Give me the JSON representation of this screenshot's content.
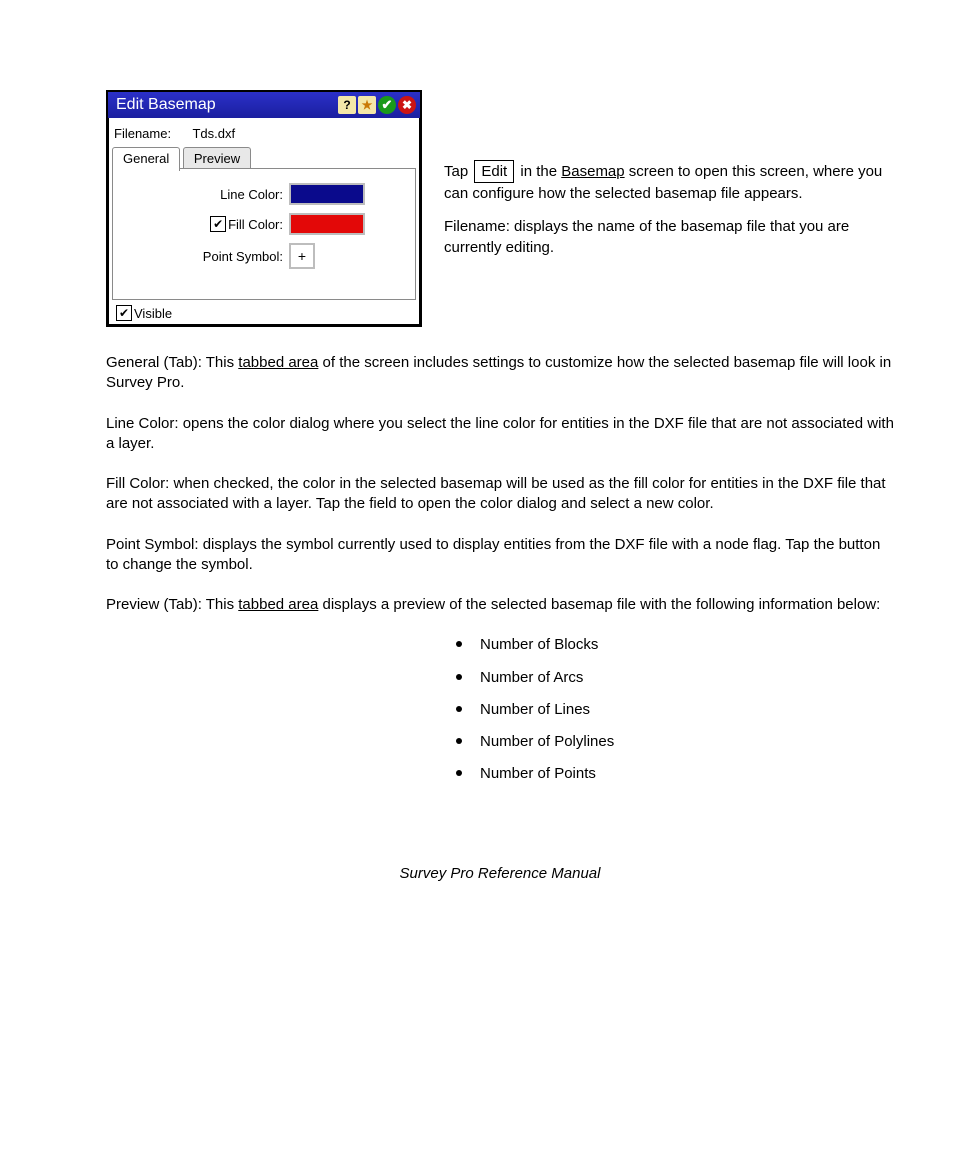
{
  "dialog": {
    "title": "Edit Basemap",
    "filename_label": "Filename:",
    "filename_value": "Tds.dxf",
    "tab_general": "General",
    "tab_preview": "Preview",
    "row_line": "Line Color:",
    "row_fill": "Fill Color:",
    "row_point": "Point Symbol:",
    "point_symbol": "+",
    "visible_label": "Visible",
    "line_color": "#0a0a8c",
    "fill_color": "#e30808",
    "icon_help": "?",
    "icon_star": "★",
    "icon_ok": "✔",
    "icon_cancel": "✖",
    "checkbox_mark": "✔"
  },
  "right": {
    "p1a": "Tap ",
    "p1_btn": "Edit",
    "p1b": " in the ",
    "p1_link": "Basemap",
    "p1c": " screen to open this screen, where you can configure how the selected basemap file appears.",
    "p2": "Filename: displays the name of the basemap file that you are currently editing."
  },
  "body": {
    "p3a": "General (Tab): This ",
    "p3_link": "tabbed area",
    "p3b": " of the screen includes settings to customize how the selected basemap file will look in Survey Pro.",
    "p4": "Line Color: opens the color dialog where you select the line color for entities in the DXF file that are not associated with a layer.",
    "p5": "Fill Color: when checked, the color in the selected basemap will be used as the fill color for entities in the DXF file that are not associated with a layer. Tap the field to open the color dialog and select a new color.",
    "p6": "Point Symbol: displays the symbol currently used to display entities from the DXF file with a node flag. Tap the button to change the symbol.",
    "p7a": "Preview (Tab): This ",
    "p7_link": "tabbed area",
    "p7b": " displays a preview of the selected basemap file with the following information below:"
  },
  "bullets": [
    "Number of Blocks",
    "Number of Arcs",
    "Number of Lines",
    "Number of Polylines",
    "Number of Points"
  ],
  "footer": "Survey Pro Reference Manual"
}
